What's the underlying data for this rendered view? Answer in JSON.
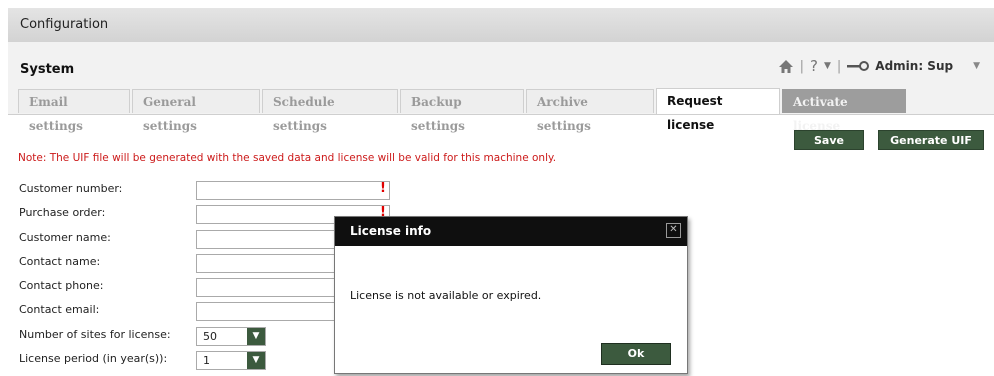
{
  "header": {
    "title": "Configuration"
  },
  "system": {
    "title": "System",
    "user_label": "Admin: Sup",
    "help_label": "?"
  },
  "tabs": [
    {
      "label": "Email settings"
    },
    {
      "label": "General settings"
    },
    {
      "label": "Schedule settings"
    },
    {
      "label": "Backup settings"
    },
    {
      "label": "Archive settings"
    },
    {
      "label": "Request license"
    },
    {
      "label": "Activate license"
    }
  ],
  "toolbar": {
    "save_label": "Save",
    "generate_label": "Generate UIF"
  },
  "note": "Note: The UIF file will be generated with the saved data and license will be valid for this machine only.",
  "form": {
    "customer_number": {
      "label": "Customer number:",
      "value": ""
    },
    "purchase_order": {
      "label": "Purchase order:",
      "value": ""
    },
    "customer_name": {
      "label": "Customer name:",
      "value": ""
    },
    "contact_name": {
      "label": "Contact name:",
      "value": ""
    },
    "contact_phone": {
      "label": "Contact phone:",
      "value": ""
    },
    "contact_email": {
      "label": "Contact email:",
      "value": ""
    },
    "sites": {
      "label": "Number of sites for license:",
      "value": "50"
    },
    "period": {
      "label": "License period (in year(s)):",
      "value": "1"
    },
    "required_mark": "!"
  },
  "modal": {
    "title": "License info",
    "close_glyph": "✕",
    "message": "License is not available or expired.",
    "ok_label": "Ok"
  },
  "colors": {
    "accent_green": "#3c5a3e",
    "note_red": "#cc1a1a",
    "required_red": "#e00000",
    "modal_header": "#0f0f0f"
  },
  "icons": [
    "home-icon",
    "help-icon",
    "key-icon",
    "dropdown-arrow-icon",
    "close-icon"
  ]
}
